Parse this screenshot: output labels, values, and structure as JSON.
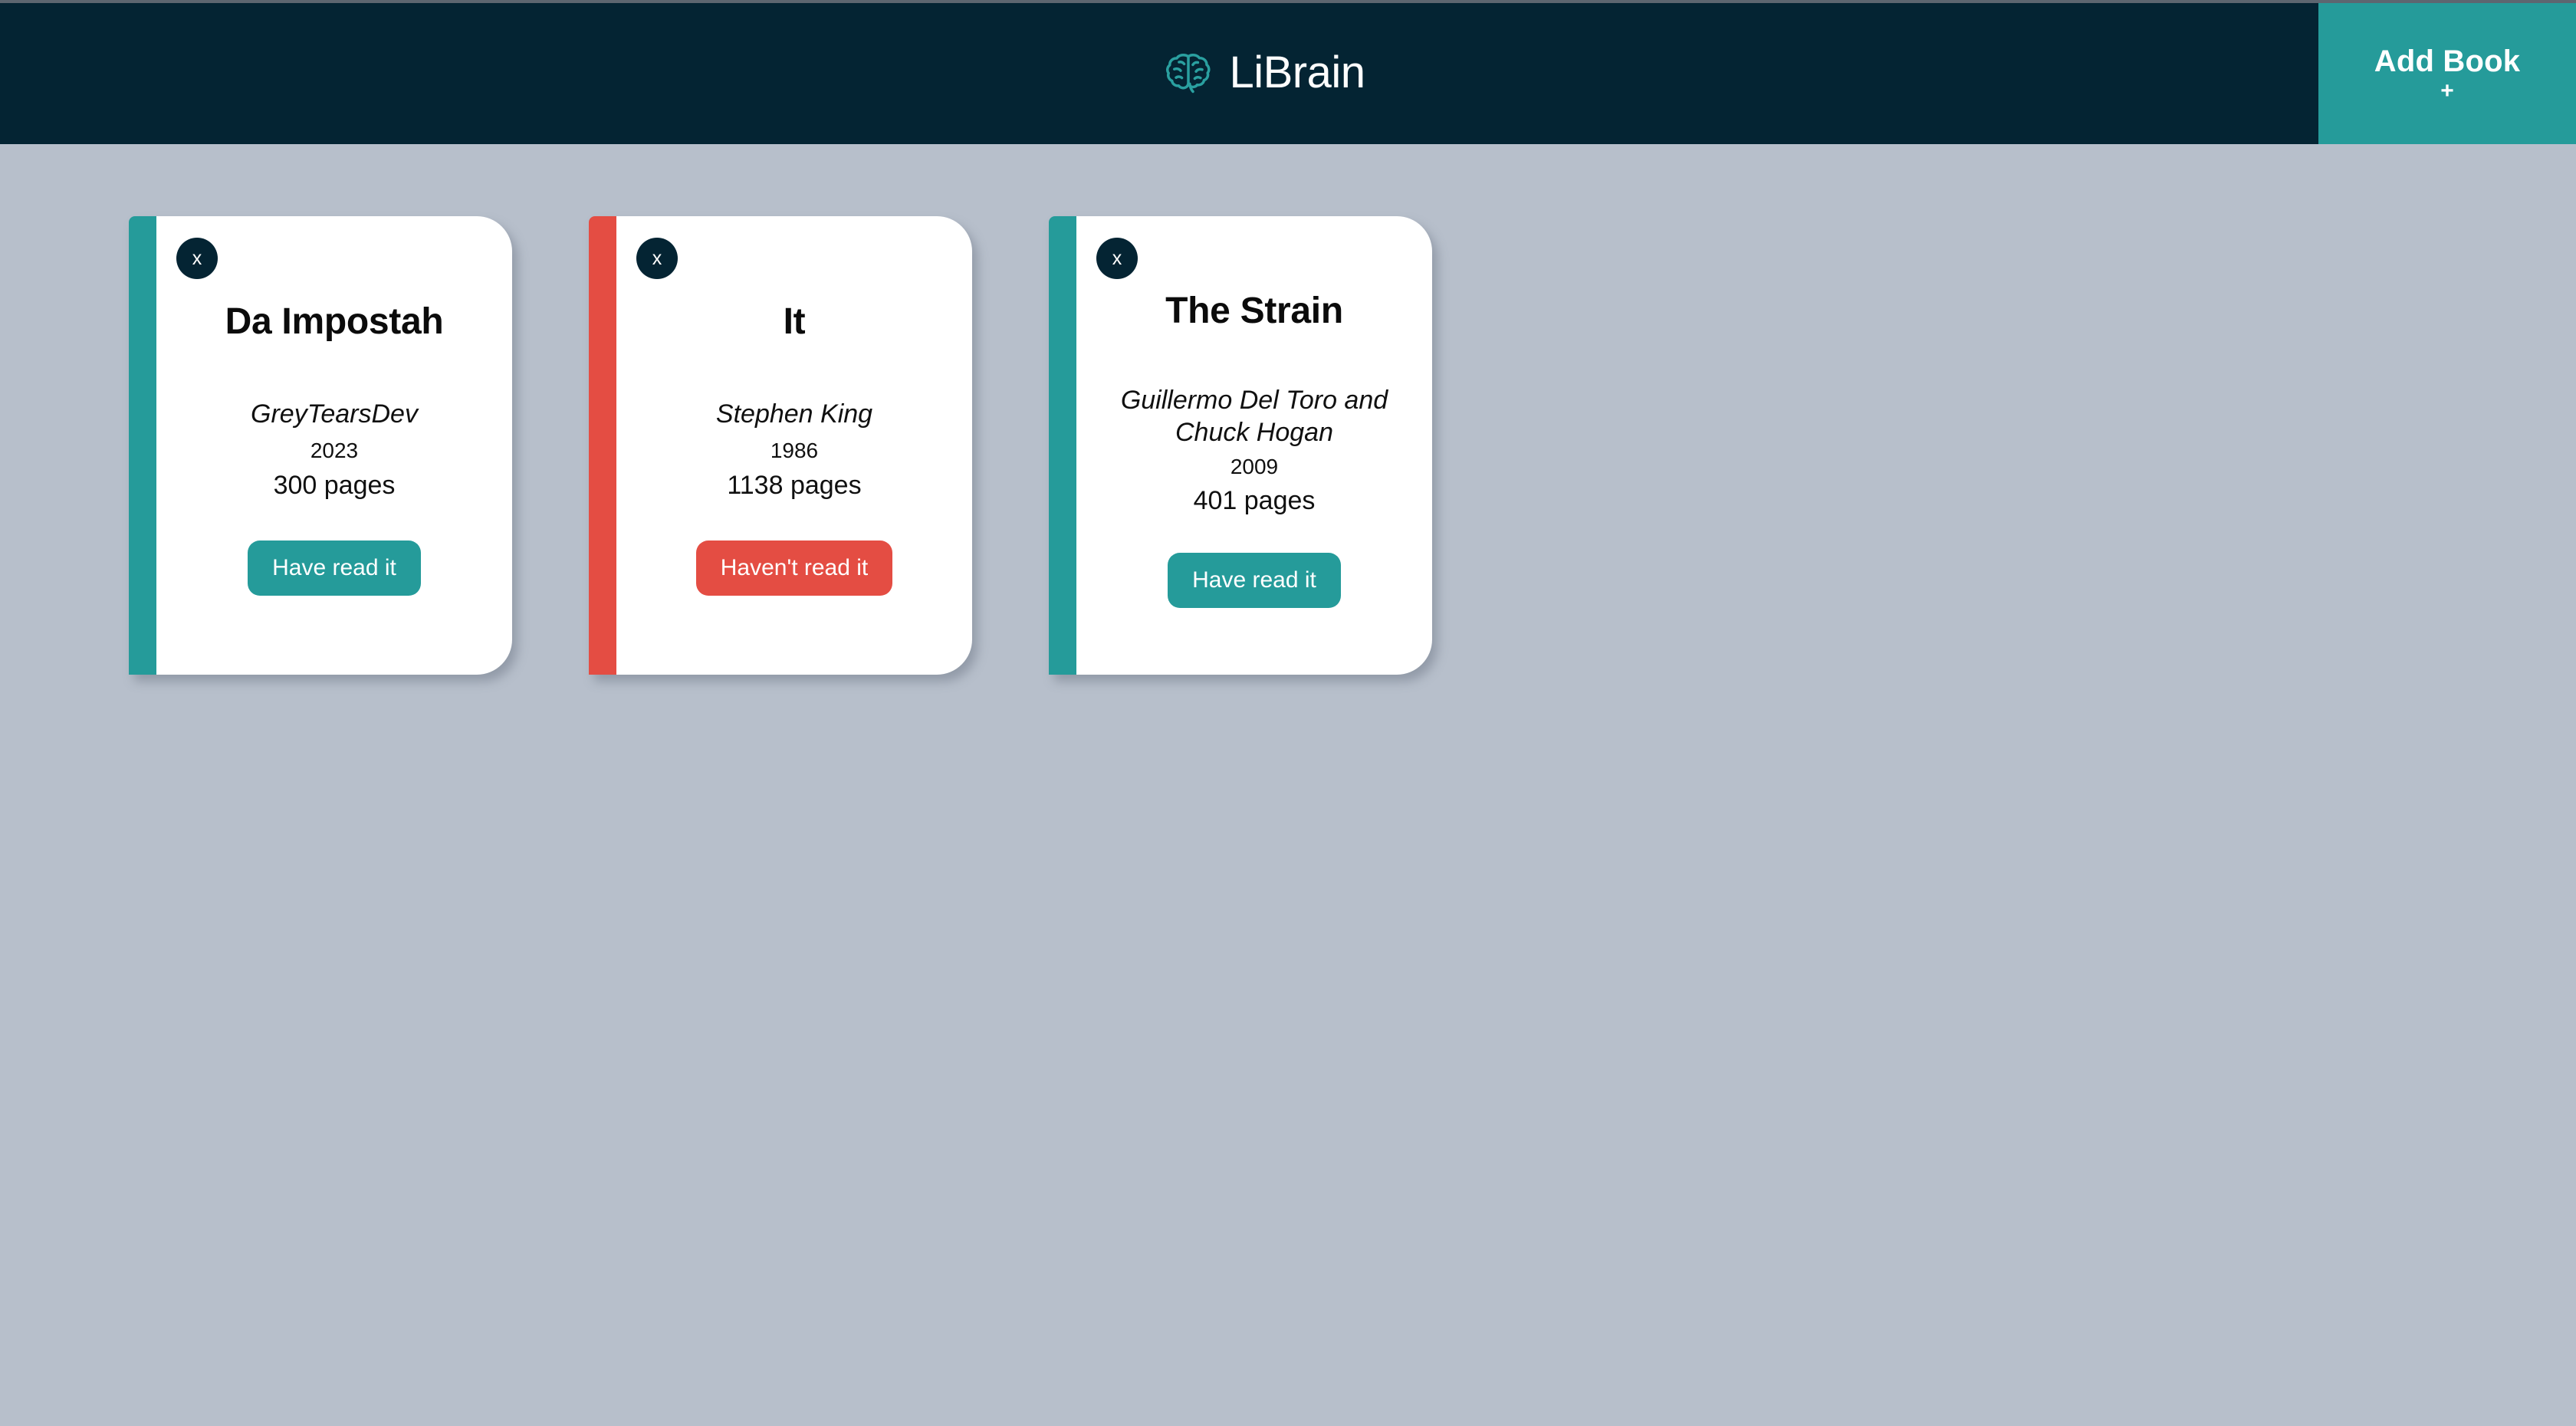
{
  "header": {
    "brand_name": "LiBrain",
    "brand_icon": "brain-icon",
    "add_book": {
      "label": "Add Book",
      "plus": "+"
    },
    "background_color": "#042433",
    "accent_color": "#259b9a"
  },
  "page": {
    "background_color": "#b7bfcb"
  },
  "colors": {
    "teal": "#259b9a",
    "red": "#e44d43",
    "navy": "#042433",
    "card": "#ffffff"
  },
  "books": [
    {
      "title": "Da Impostah",
      "author": "GreyTearsDev",
      "year": "2023",
      "pages": "300 pages",
      "read_label": "Have read it",
      "read_state": "read",
      "spine_color": "#259b9a",
      "close_label": "x",
      "author_lines": 1
    },
    {
      "title": "It",
      "author": "Stephen King",
      "year": "1986",
      "pages": "1138 pages",
      "read_label": "Haven't read it",
      "read_state": "unread",
      "spine_color": "#e44d43",
      "close_label": "x",
      "author_lines": 1
    },
    {
      "title": "The Strain",
      "author": "Guillermo Del Toro and Chuck Hogan",
      "year": "2009",
      "pages": "401 pages",
      "read_label": "Have read it",
      "read_state": "read",
      "spine_color": "#259b9a",
      "close_label": "x",
      "author_lines": 2
    }
  ]
}
